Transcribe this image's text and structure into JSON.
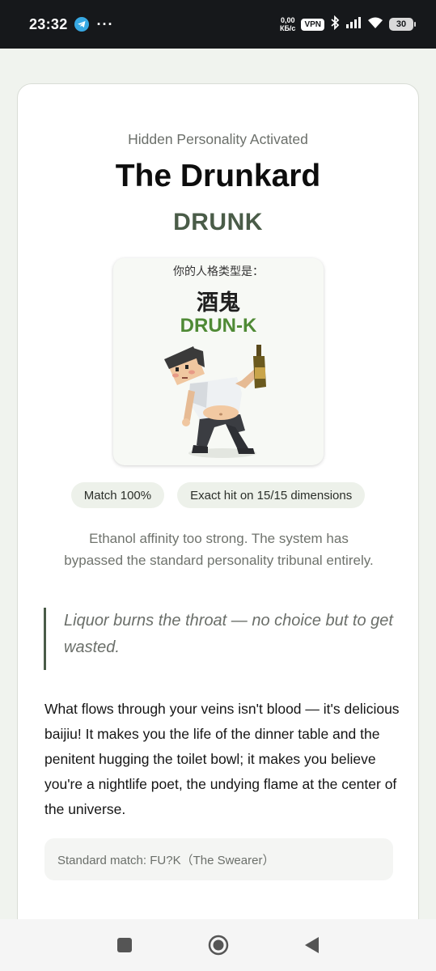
{
  "status_bar": {
    "time": "23:32",
    "dots": "···",
    "speed_value": "0,00",
    "speed_unit": "КБ/с",
    "vpn": "VPN",
    "battery": "30",
    "icons": [
      "telegram-icon",
      "bluetooth-icon",
      "signal-icon",
      "wifi-icon",
      "battery-icon"
    ]
  },
  "result": {
    "kicker": "Hidden Personality Activated",
    "title": "The Drunkard",
    "code": "DRUNK",
    "poster": {
      "subtitle": "你的人格类型是：",
      "name_cn": "酒鬼",
      "code": "DRUN-K"
    },
    "pills": {
      "match": "Match 100%",
      "dimensions": "Exact hit on 15/15 dimensions"
    },
    "description": "Ethanol affinity too strong. The system has bypassed the standard personality tribunal entirely.",
    "quote": "Liquor burns the throat — no choice but to get wasted.",
    "body": "What flows through your veins isn't blood — it's delicious baijiu! It makes you the life of the dinner table and the penitent hugging the toilet bowl; it makes you believe you're a nightlife poet, the undying flame at the center of the universe.",
    "standard_match": "Standard match: FU?K（The Swearer）"
  },
  "navbar": {
    "icons": [
      "recent-apps-icon",
      "home-icon",
      "back-icon"
    ]
  },
  "colors": {
    "accent": "#4a5c48",
    "poster_code": "#4f8a35",
    "page_bg": "#f0f3ee"
  }
}
